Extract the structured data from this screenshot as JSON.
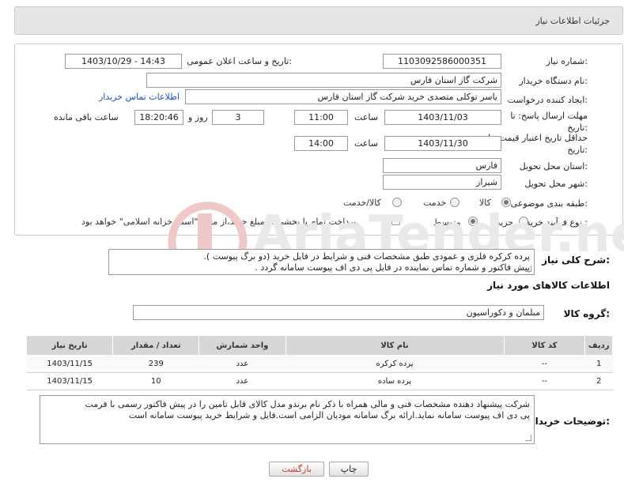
{
  "header": {
    "title": "جزئیات اطلاعات نیاز"
  },
  "form": {
    "need_number": {
      "label": "شماره نیاز:",
      "value": "1103092586000351"
    },
    "announce_datetime": {
      "label": "تاریخ و ساعت اعلان عمومی:",
      "value": "1403/10/29 - 14:43"
    },
    "buyer_org": {
      "label": "نام دستگاه خریدار:",
      "value": "شرکت گاز استان فارس"
    },
    "creator": {
      "label": "ایجاد کننده درخواست:",
      "value": "یاسر توکلی متصدی خرید شرکت گاز استان فارس",
      "contact_link": "اطلاعات تماس خریدار"
    },
    "deadline": {
      "label": "مهلت ارسال پاسخ: تا تاریخ:",
      "date": "1403/11/03",
      "time_label": "ساعت",
      "time": "11:00",
      "days": "3",
      "days_label": "روز و",
      "remaining": "18:20:46",
      "remaining_label": "ساعت باقی مانده"
    },
    "validity": {
      "label": "حداقل تاریخ اعتبار قیمت: تا تاریخ:",
      "date": "1403/11/30",
      "time_label": "ساعت",
      "time": "14:00"
    },
    "province": {
      "label": "استان محل تحویل:",
      "value": "فارس"
    },
    "city": {
      "label": "شهر محل تحویل:",
      "value": "شیراز"
    },
    "category": {
      "label": "طبقه بندی موضوعی:",
      "options": [
        "کالا",
        "خدمت",
        "کالا/خدمت"
      ],
      "selected": "کالا"
    },
    "process": {
      "label": "نوع فرآیند خرید :",
      "options": [
        "جزیی",
        "متوسط"
      ],
      "selected": "جزیی",
      "payment_note": "پرداخت تمام یا بخشی از مبلغ خرید،از محل \"اسناد خزانه اسلامی\" خواهد بود."
    }
  },
  "description": {
    "label": "شرح کلی نیاز:",
    "lines": [
      "پرده کرکره فلزی و عمودی طبق مشخصات فنی و شرایط در فایل خرید (دو برگ پیوست ).",
      "پیش فاکتور و شماره تماس نماینده در فایل پی دی اف پیوست سامانه گردد ."
    ]
  },
  "goods_section": {
    "title": "اطلاعات کالاهای مورد نیاز",
    "group_label": "گروه کالا:",
    "group_value": "مبلمان و دکوراسیون"
  },
  "items_table": {
    "headers": [
      "ردیف",
      "کد کالا",
      "نام کالا",
      "واحد شمارش",
      "تعداد / مقدار",
      "تاریخ نیاز"
    ],
    "rows": [
      [
        "1",
        "--",
        "پرده کرکره",
        "عدد",
        "239",
        "1403/11/15"
      ],
      [
        "2",
        "--",
        "پرده ساده",
        "عدد",
        "10",
        "1403/11/15"
      ]
    ]
  },
  "buyer_notes": {
    "label": "توضیحات خریدار:",
    "lines": [
      "شرکت پیشنهاد دهنده مشخصات فنی و مالی همراه با ذکر نام برندو مدل کالای قابل تامین را در پیش فاکتور رسمی با فرمت",
      "پی دی اف پیوست سامانه نماید.ارائه برگ سامانه مودیان الزامی است.فایل و شرایط خرید پیوست سامانه است"
    ]
  },
  "buttons": {
    "print": "چاپ",
    "back": "بازگشت"
  },
  "watermark": {
    "text": "AriaTender.net"
  }
}
